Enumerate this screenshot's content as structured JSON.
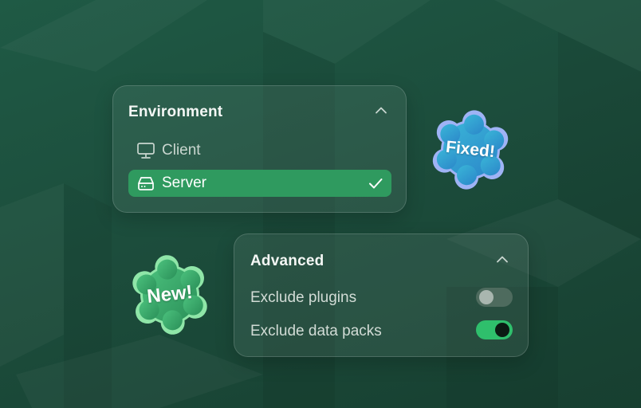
{
  "environment": {
    "title": "Environment",
    "options": [
      {
        "label": "Client",
        "icon": "monitor-icon",
        "selected": false
      },
      {
        "label": "Server",
        "icon": "server-icon",
        "selected": true
      }
    ]
  },
  "advanced": {
    "title": "Advanced",
    "rows": [
      {
        "label": "Exclude plugins",
        "enabled": false
      },
      {
        "label": "Exclude data packs",
        "enabled": true
      }
    ]
  },
  "badges": {
    "fixed": "Fixed!",
    "new": "New!"
  },
  "colors": {
    "accent": "#2fbf6c",
    "selected_row": "#2f9a5f",
    "fixed_badge": "#2aa6d6",
    "new_badge": "#35a96a"
  }
}
